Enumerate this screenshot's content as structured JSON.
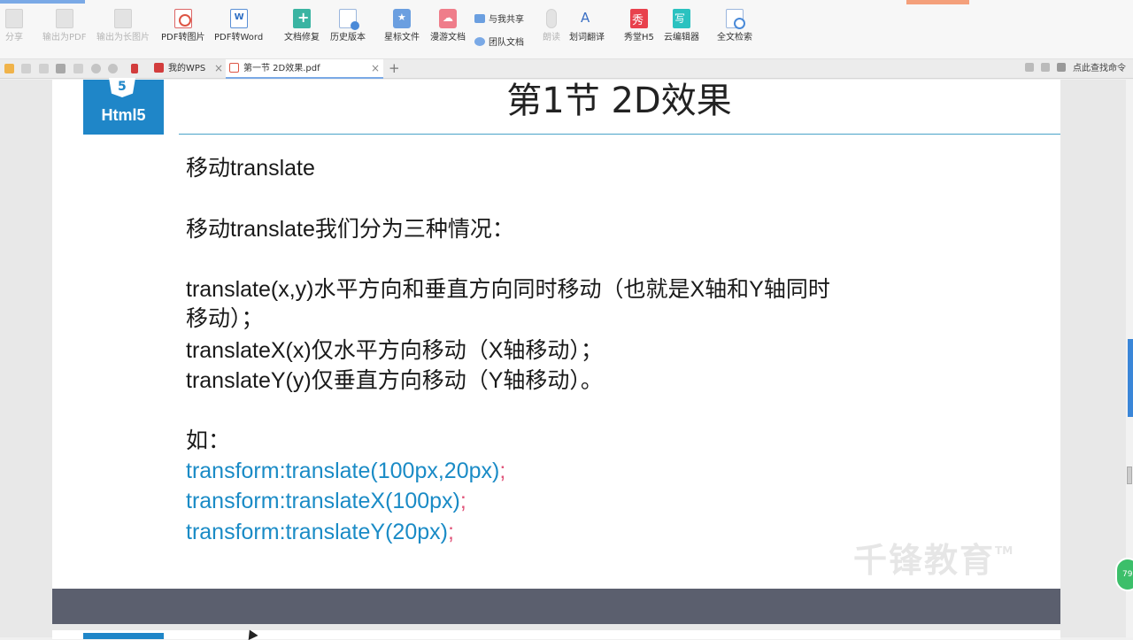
{
  "ribbon": {
    "tools": [
      {
        "label": "分享",
        "icon": "share-icon"
      },
      {
        "label": "输出为PDF",
        "icon": "export-pdf-icon"
      },
      {
        "label": "输出为长图片",
        "icon": "export-long-image-icon"
      },
      {
        "label": "PDF转图片",
        "icon": "pdf-to-image-icon"
      },
      {
        "label": "PDF转Word",
        "icon": "pdf-to-word-icon"
      },
      {
        "label": "文档修复",
        "icon": "document-repair-icon"
      },
      {
        "label": "历史版本",
        "icon": "history-version-icon"
      },
      {
        "label": "星标文件",
        "icon": "starred-folder-icon"
      },
      {
        "label": "漫游文档",
        "icon": "roaming-folder-icon"
      },
      {
        "label": "朗读",
        "icon": "microphone-icon"
      },
      {
        "label": "划词翻译",
        "icon": "translate-icon"
      },
      {
        "label": "秀堂H5",
        "icon": "xiutang-icon"
      },
      {
        "label": "云编辑器",
        "icon": "cloud-editor-icon"
      },
      {
        "label": "全文检索",
        "icon": "full-text-search-icon"
      }
    ],
    "share_with_me": "与我共享",
    "team_docs": "团队文档"
  },
  "tabbar": {
    "tabs": [
      {
        "label": "我的WPS",
        "icon": "wps-logo-icon"
      },
      {
        "label": "第一节 2D效果.pdf",
        "icon": "pdf-file-icon"
      }
    ],
    "close_glyph": "×",
    "add_glyph": "+",
    "search_command": "点此查找命令"
  },
  "slide": {
    "logo_text": "Html5",
    "title": "第1节 2D效果",
    "lines": {
      "heading": "移动translate",
      "intro": "移动translate我们分为三种情况：",
      "case1a": "translate(x,y)水平方向和垂直方向同时移动（也就是X轴和Y轴同时",
      "case1b": "移动）；",
      "case2": "translateX(x)仅水平方向移动（X轴移动）；",
      "case3": "translateY(y)仅垂直方向移动（Y轴移动）。",
      "example_label": "如："
    },
    "code": [
      {
        "text": "transform:translate(100px,20px)",
        "semi": ";"
      },
      {
        "text": "transform:translateX(100px)",
        "semi": ";"
      },
      {
        "text": "transform:translateY(20px)",
        "semi": ";"
      }
    ],
    "watermark": "千锋教育",
    "watermark_tm": "TM"
  },
  "floating_badge": "79",
  "colors": {
    "accent": "#1f86c8",
    "code": "#1a8bc6",
    "semicolon": "#e0557a",
    "page_gap": "#5b5f6e"
  }
}
